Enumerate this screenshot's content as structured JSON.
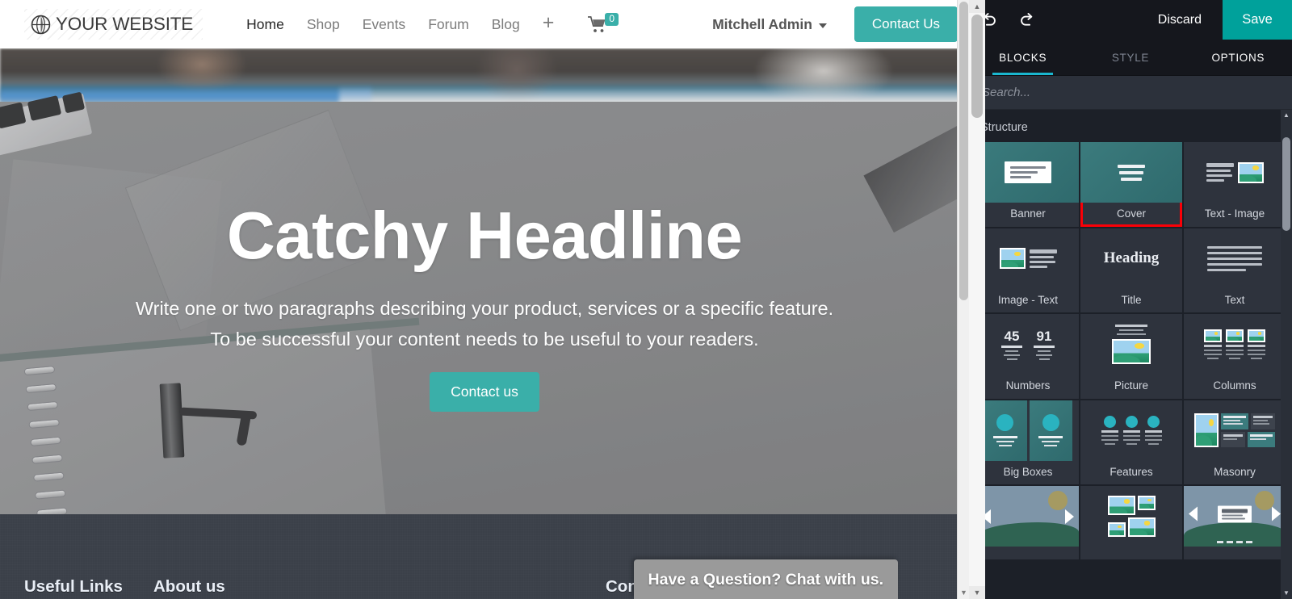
{
  "website": {
    "brand": {
      "name": "YOUR WEBSITE",
      "icon": "globe-icon"
    },
    "nav_links": [
      {
        "label": "Home",
        "active": true
      },
      {
        "label": "Shop",
        "active": false
      },
      {
        "label": "Events",
        "active": false
      },
      {
        "label": "Forum",
        "active": false
      },
      {
        "label": "Blog",
        "active": false
      }
    ],
    "add_page_icon": "+",
    "cart": {
      "icon": "cart-icon",
      "count": "0"
    },
    "user": {
      "name": "Mitchell Admin",
      "caret": "chevron-down-icon"
    },
    "contact_button": "Contact Us",
    "hero": {
      "title": "Catchy Headline",
      "paragraph_line1": "Write one or two paragraphs describing your product, services or a specific feature.",
      "paragraph_line2": "To be successful your content needs to be useful to your readers.",
      "cta": "Contact us"
    },
    "footer": {
      "columns": [
        {
          "title": "Useful Links"
        },
        {
          "title": "About us"
        },
        {
          "title": "Connect"
        }
      ]
    },
    "chat_widget": {
      "text": "Have a Question? Chat with us."
    }
  },
  "editor": {
    "toolbar": {
      "undo_icon": "undo-icon",
      "redo_icon": "redo-icon",
      "discard_label": "Discard",
      "save_label": "Save"
    },
    "tabs": [
      {
        "label": "BLOCKS",
        "state": "active"
      },
      {
        "label": "STYLE",
        "state": "dim"
      },
      {
        "label": "OPTIONS",
        "state": "normal"
      }
    ],
    "search": {
      "placeholder": "Search...",
      "value": ""
    },
    "sections": [
      {
        "title": "Structure",
        "blocks": [
          {
            "label": "Banner",
            "thumb": "banner",
            "selected": false
          },
          {
            "label": "Cover",
            "thumb": "cover",
            "selected": true
          },
          {
            "label": "Text - Image",
            "thumb": "text-image",
            "selected": false
          },
          {
            "label": "Image - Text",
            "thumb": "image-text",
            "selected": false
          },
          {
            "label": "Title",
            "thumb": "title",
            "selected": false
          },
          {
            "label": "Text",
            "thumb": "text",
            "selected": false
          },
          {
            "label": "Numbers",
            "thumb": "numbers",
            "selected": false
          },
          {
            "label": "Picture",
            "thumb": "picture",
            "selected": false
          },
          {
            "label": "Columns",
            "thumb": "columns",
            "selected": false
          },
          {
            "label": "Big Boxes",
            "thumb": "big-boxes",
            "selected": false
          },
          {
            "label": "Features",
            "thumb": "features",
            "selected": false
          },
          {
            "label": "Masonry",
            "thumb": "masonry",
            "selected": false
          },
          {
            "label": "",
            "thumb": "carousel",
            "selected": false
          },
          {
            "label": "",
            "thumb": "gallery",
            "selected": false
          },
          {
            "label": "",
            "thumb": "slider",
            "selected": false
          }
        ]
      }
    ],
    "numbers_thumb": {
      "n1": "45",
      "n2": "91"
    },
    "title_thumb_text": "Heading"
  },
  "colors": {
    "brand_teal": "#3aafa9",
    "save_teal": "#00a19b",
    "tab_underline": "#1ab7cf",
    "selection_red": "#fb0007",
    "panel_bg": "#1c2028",
    "panel_dark": "#15171d",
    "card_bg": "#2e333d",
    "footer_bg": "#3b4049"
  }
}
